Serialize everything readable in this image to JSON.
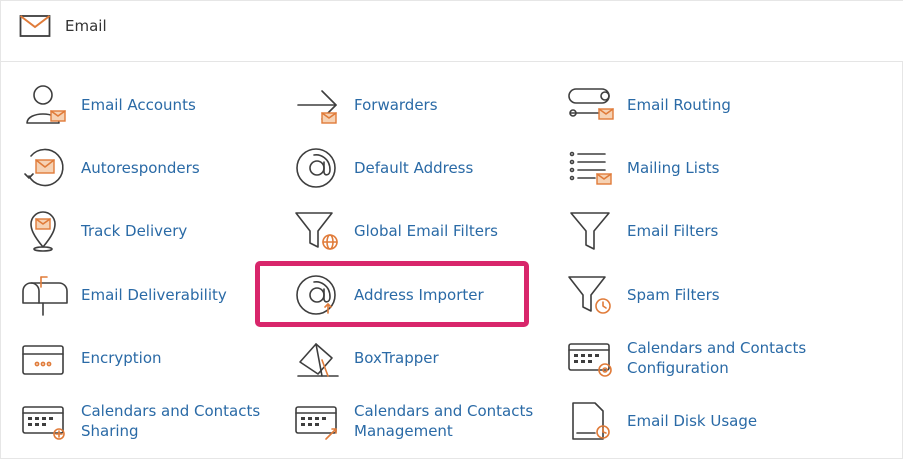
{
  "section": {
    "title": "Email",
    "icon": "envelope-icon"
  },
  "items": [
    {
      "label": "Email Accounts",
      "icon": "user-mail-icon"
    },
    {
      "label": "Forwarders",
      "icon": "forward-arrow-icon"
    },
    {
      "label": "Email Routing",
      "icon": "routing-icon"
    },
    {
      "label": "Autoresponders",
      "icon": "autoresponder-icon"
    },
    {
      "label": "Default Address",
      "icon": "at-sign-icon"
    },
    {
      "label": "Mailing Lists",
      "icon": "list-mail-icon"
    },
    {
      "label": "Track Delivery",
      "icon": "map-pin-mail-icon"
    },
    {
      "label": "Global Email Filters",
      "icon": "funnel-globe-icon"
    },
    {
      "label": "Email Filters",
      "icon": "funnel-icon"
    },
    {
      "label": "Email Deliverability",
      "icon": "mailbox-icon"
    },
    {
      "label": "Address Importer",
      "icon": "at-sign-import-icon"
    },
    {
      "label": "Spam Filters",
      "icon": "funnel-clock-icon"
    },
    {
      "label": "Encryption",
      "icon": "lock-box-icon"
    },
    {
      "label": "BoxTrapper",
      "icon": "box-trap-icon"
    },
    {
      "label": "Calendars and Contacts Configuration",
      "icon": "calendar-gear-icon"
    },
    {
      "label": "Calendars and Contacts Sharing",
      "icon": "calendar-share-icon"
    },
    {
      "label": "Calendars and Contacts Management",
      "icon": "calendar-manage-icon"
    },
    {
      "label": "Email Disk Usage",
      "icon": "disk-usage-icon"
    }
  ],
  "colors": {
    "link": "#2a6aa6",
    "accent": "#e07b39",
    "highlight": "#d8266b"
  }
}
